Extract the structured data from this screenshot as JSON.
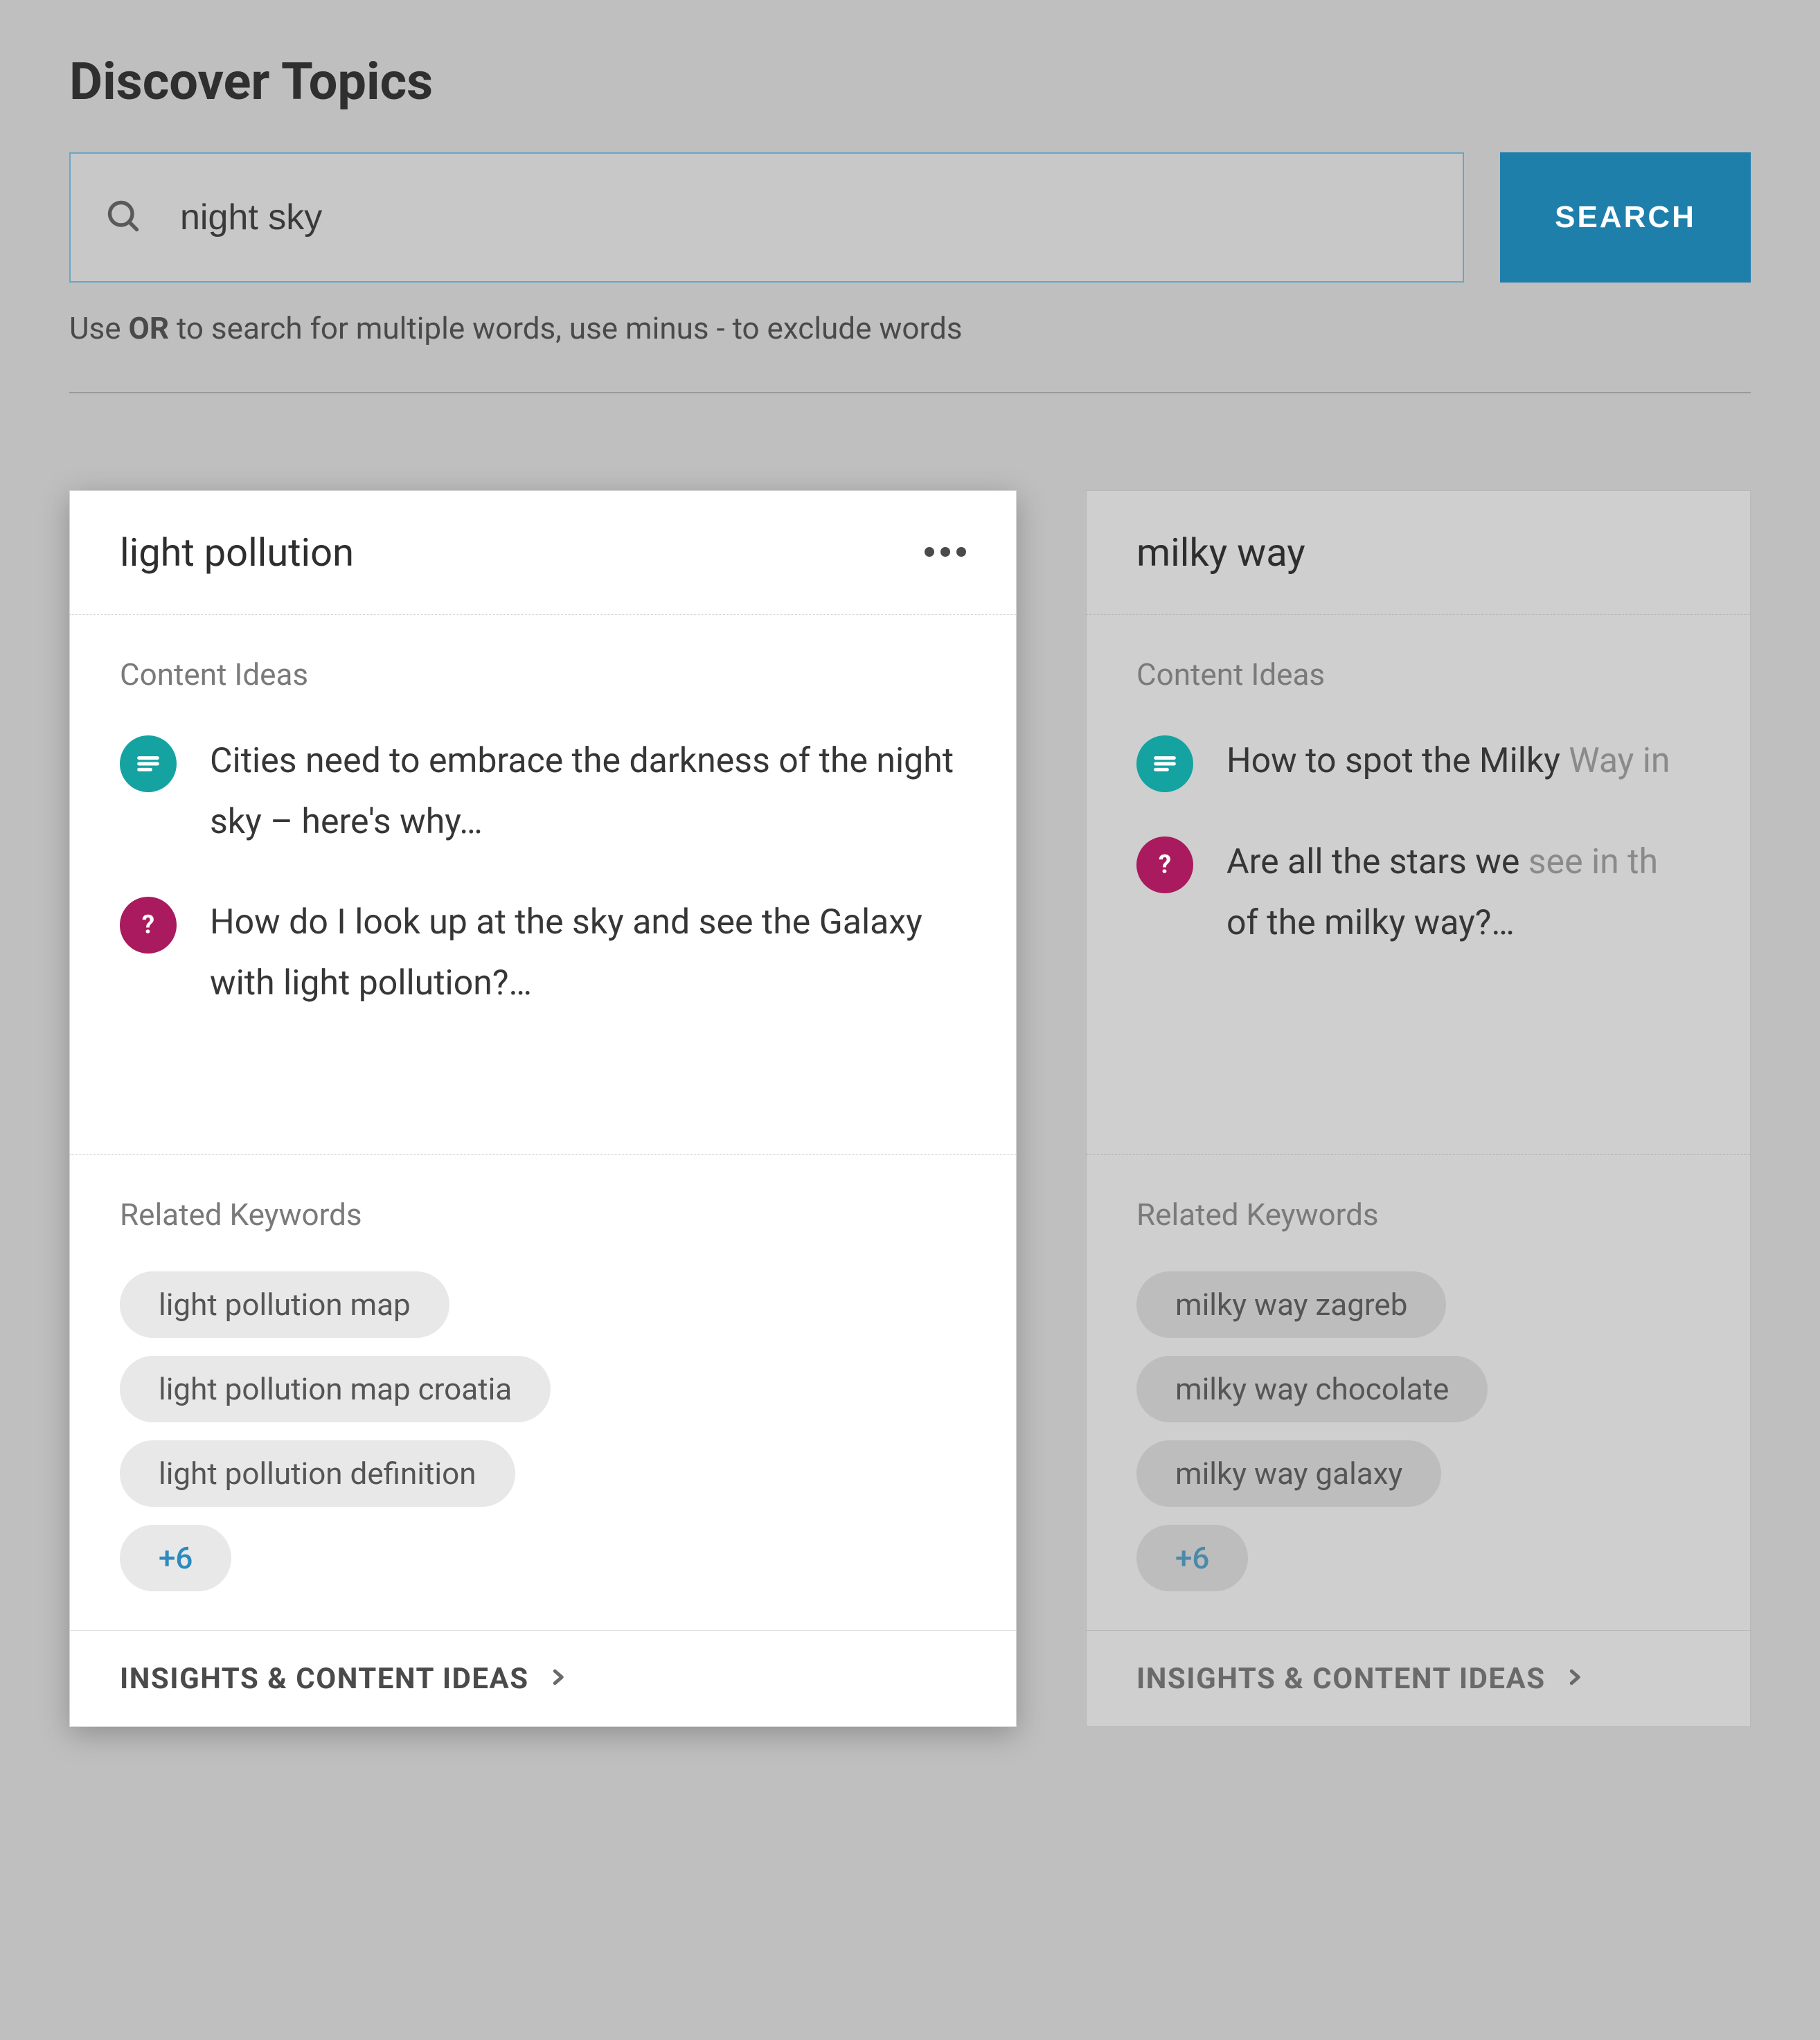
{
  "page_title": "Discover Topics",
  "search": {
    "value": "night sky",
    "button_label": "SEARCH",
    "hint_prefix": "Use ",
    "hint_bold": "OR",
    "hint_suffix": " to search for multiple words, use minus - to exclude words"
  },
  "section_labels": {
    "content_ideas": "Content Ideas",
    "related_keywords": "Related Keywords",
    "footer": "INSIGHTS & CONTENT IDEAS"
  },
  "cards": [
    {
      "title": "light pollution",
      "ideas": [
        {
          "type": "article",
          "text": "Cities need to embrace the darkness of the night sky – here's why…"
        },
        {
          "type": "question",
          "text": "How do I look up at the sky and see the Galaxy with light pollution?…"
        }
      ],
      "keywords": [
        "light pollution map",
        "light pollution map croatia",
        "light pollution definition"
      ],
      "more_keywords": "+6"
    },
    {
      "title": "milky way",
      "ideas": [
        {
          "type": "article",
          "text_visible": "How to spot the Milky ",
          "text_faded": "Way in"
        },
        {
          "type": "question",
          "text_visible": "Are all the stars we ",
          "text_faded": "see in th",
          "text_line2": "of the milky way?…"
        }
      ],
      "keywords": [
        "milky way zagreb",
        "milky way chocolate",
        "milky way galaxy"
      ],
      "more_keywords": "+6"
    }
  ]
}
